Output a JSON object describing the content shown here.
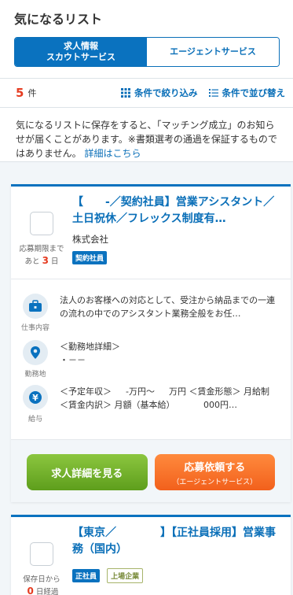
{
  "header": {
    "title": "気になるリスト"
  },
  "segment": {
    "active_line1": "求人情報",
    "active_line2": "スカウトサービス",
    "inactive": "エージェントサービス"
  },
  "toolbar": {
    "count": "5",
    "count_unit": "件",
    "filter_label": "条件で絞り込み",
    "sort_label": "条件で並び替え"
  },
  "notice": {
    "text": "気になるリストに保存をすると、「マッチング成立」のお知らせが届くことがあります。※書類選考の通過を保証するものではありません。",
    "link": "詳細はこちら"
  },
  "cards": [
    {
      "title": "【　　-／契約社員】営業アシスタント／土日祝休／フレックス制度有…",
      "company": "株式会社　　　　　",
      "tags": [
        "契約社員"
      ],
      "deadline_prefix": "応募期限まで",
      "deadline_before": "あと",
      "deadline_days": "3",
      "deadline_after": "日",
      "job_label": "仕事内容",
      "job_text": "法人のお客様への対応として、受注から納品までの一連の流れの中でのアシスタント業務全般をお任…",
      "location_label": "勤務地",
      "location_text": "＜勤務地詳細＞\n・－－",
      "salary_label": "給与",
      "salary_text": "＜予定年収＞ 　 -万円～ 　 万円 ＜賃金形態＞ 月給制 ＜賃金内訳＞ 月額（基本給） 　　　000円…",
      "detail_button": "求人詳細を見る",
      "apply_button": "応募依頼する",
      "apply_sub": "（エージェントサービス）"
    },
    {
      "title": "【東京／　　　　】【正社員採用】営業事務（国内）",
      "tags": [
        "正社員",
        "上場企業"
      ],
      "deadline_prefix": "保存日から",
      "deadline_days": "0",
      "deadline_after": "日経過"
    }
  ],
  "colors": {
    "brand_blue": "#0a72bf",
    "count_red": "#e53b20",
    "green_button": "#6aad27",
    "orange_button": "#f57428"
  }
}
